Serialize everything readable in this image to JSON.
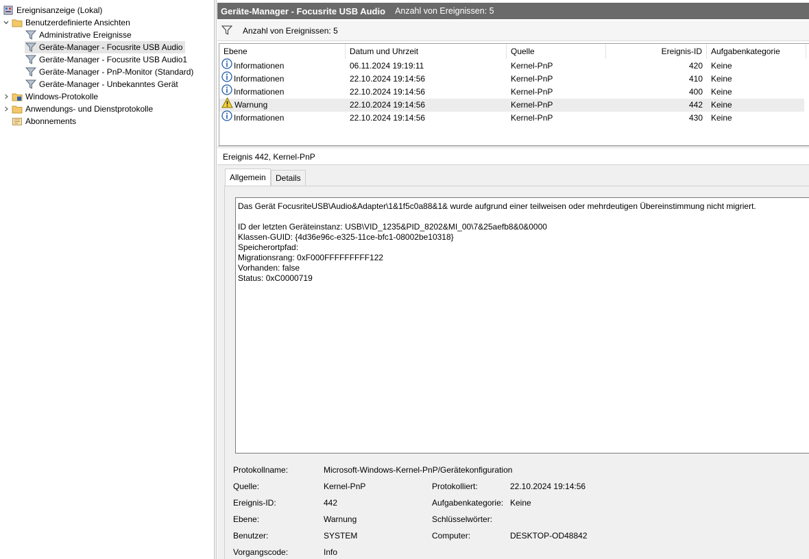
{
  "tree": {
    "root": "Ereignisanzeige (Lokal)",
    "custom_views": "Benutzerdefinierte Ansichten",
    "items": [
      "Administrative Ereignisse",
      "Geräte-Manager - Focusrite USB Audio",
      "Geräte-Manager - Focusrite USB Audio1",
      "Geräte-Manager - PnP-Monitor (Standard)",
      "Geräte-Manager - Unbekanntes Gerät"
    ],
    "windows_logs": "Windows-Protokolle",
    "app_logs": "Anwendungs- und Dienstprotokolle",
    "subscriptions": "Abonnements"
  },
  "header": {
    "title": "Geräte-Manager - Focusrite USB Audio",
    "count": "Anzahl von Ereignissen: 5"
  },
  "filter": {
    "text": "Anzahl von Ereignissen: 5"
  },
  "grid": {
    "columns": [
      "Ebene",
      "Datum und Uhrzeit",
      "Quelle",
      "Ereignis-ID",
      "Aufgabenkategorie"
    ],
    "rows": [
      {
        "level": "Informationen",
        "icon": "info-icon",
        "date": "06.11.2024 19:19:11",
        "source": "Kernel-PnP",
        "id": "420",
        "category": "Keine"
      },
      {
        "level": "Informationen",
        "icon": "info-icon",
        "date": "22.10.2024 19:14:56",
        "source": "Kernel-PnP",
        "id": "410",
        "category": "Keine"
      },
      {
        "level": "Informationen",
        "icon": "info-icon",
        "date": "22.10.2024 19:14:56",
        "source": "Kernel-PnP",
        "id": "400",
        "category": "Keine"
      },
      {
        "level": "Warnung",
        "icon": "warning-icon",
        "date": "22.10.2024 19:14:56",
        "source": "Kernel-PnP",
        "id": "442",
        "category": "Keine"
      },
      {
        "level": "Informationen",
        "icon": "info-icon",
        "date": "22.10.2024 19:14:56",
        "source": "Kernel-PnP",
        "id": "430",
        "category": "Keine"
      }
    ]
  },
  "detail": {
    "title": "Ereignis 442, Kernel-PnP",
    "tabs": [
      "Allgemein",
      "Details"
    ],
    "message": [
      "Das Gerät FocusriteUSB\\Audio&Adapter\\1&1f5c0a88&1& wurde aufgrund einer teilweisen oder mehrdeutigen Übereinstimmung nicht migriert.",
      "",
      "ID der letzten Geräteinstanz: USB\\VID_1235&PID_8202&MI_00\\7&25aefb8&0&0000",
      "Klassen-GUID: {4d36e96c-e325-11ce-bfc1-08002be10318}",
      "Speicherortpfad:",
      "Migrationsrang: 0xF000FFFFFFFFF122",
      "Vorhanden: false",
      "Status: 0xC0000719"
    ],
    "props": {
      "log_name_label": "Protokollname:",
      "log_name": "Microsoft-Windows-Kernel-PnP/Gerätekonfiguration",
      "source_label": "Quelle:",
      "source": "Kernel-PnP",
      "logged_label": "Protokolliert:",
      "logged": "22.10.2024 19:14:56",
      "event_id_label": "Ereignis-ID:",
      "event_id": "442",
      "task_label": "Aufgabenkategorie:",
      "task": "Keine",
      "level_label": "Ebene:",
      "level": "Warnung",
      "keywords_label": "Schlüsselwörter:",
      "keywords": "",
      "user_label": "Benutzer:",
      "user": "SYSTEM",
      "computer_label": "Computer:",
      "computer": "DESKTOP-OD48842",
      "opcode_label": "Vorgangscode:",
      "opcode": "Info"
    }
  }
}
